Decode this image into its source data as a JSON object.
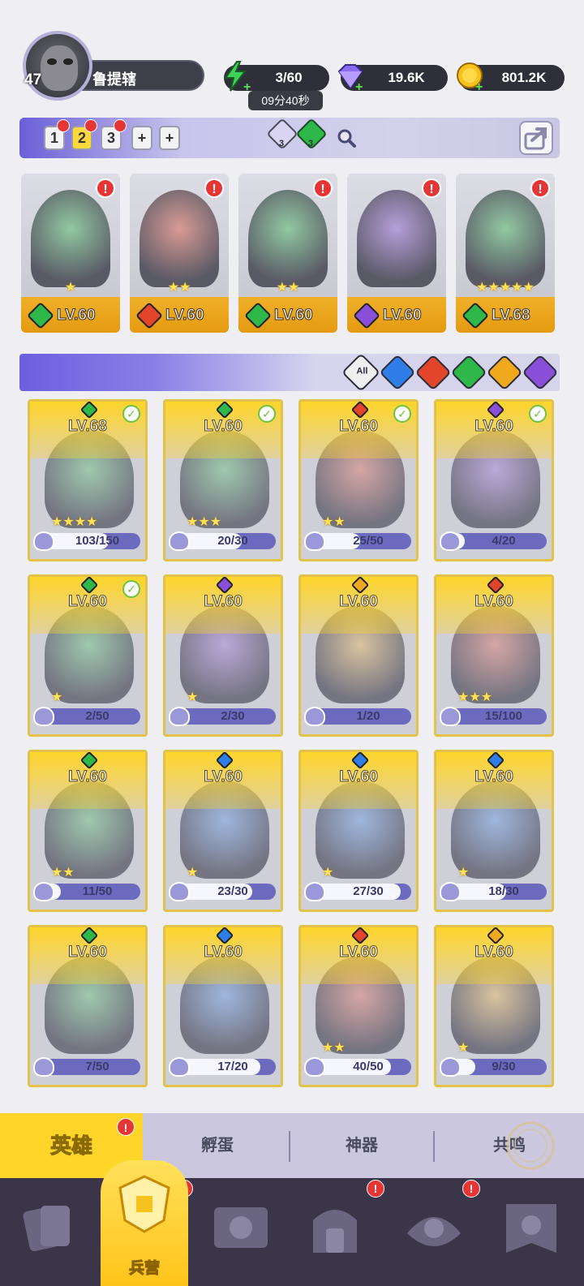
{
  "player": {
    "level": "47",
    "name": "鲁提辖"
  },
  "resources": {
    "energy": "3/60",
    "energy_timer": "09分40秒",
    "gems": "19.6K",
    "gold": "801.2K"
  },
  "team_bar": {
    "slots": [
      "1",
      "2",
      "3",
      "+",
      "+"
    ],
    "active_slot": 1,
    "gem_counts": [
      "3",
      "3"
    ]
  },
  "team": [
    {
      "element": "green",
      "level": "LV.60",
      "stars": "★",
      "alert": "!"
    },
    {
      "element": "red",
      "level": "LV.60",
      "stars": "★★",
      "alert": "!"
    },
    {
      "element": "green",
      "level": "LV.60",
      "stars": "★★",
      "alert": "!"
    },
    {
      "element": "purple",
      "level": "LV.60",
      "stars": "",
      "alert": "!"
    },
    {
      "element": "green",
      "level": "LV.68",
      "stars": "★★★★★",
      "alert": "!"
    }
  ],
  "filters": {
    "all_label": "All",
    "elements": [
      "blue",
      "red",
      "green",
      "yellow",
      "purple"
    ]
  },
  "heroes": [
    {
      "element": "green",
      "level": "LV.68",
      "shards": "103/150",
      "progress": 0.69,
      "check": true,
      "stars": "★★★★"
    },
    {
      "element": "green",
      "level": "LV.60",
      "shards": "20/30",
      "progress": 0.67,
      "check": true,
      "stars": "★★★"
    },
    {
      "element": "red",
      "level": "LV.60",
      "shards": "25/50",
      "progress": 0.5,
      "check": true,
      "stars": "★★"
    },
    {
      "element": "purple",
      "level": "LV.60",
      "shards": "4/20",
      "progress": 0.2,
      "check": true,
      "stars": ""
    },
    {
      "element": "green",
      "level": "LV.60",
      "shards": "2/50",
      "progress": 0.04,
      "check": true,
      "stars": "★"
    },
    {
      "element": "purple",
      "level": "LV.60",
      "shards": "2/30",
      "progress": 0.07,
      "check": false,
      "stars": "★"
    },
    {
      "element": "yellow",
      "level": "LV.60",
      "shards": "1/20",
      "progress": 0.05,
      "check": false,
      "stars": ""
    },
    {
      "element": "red",
      "level": "LV.60",
      "shards": "15/100",
      "progress": 0.15,
      "check": false,
      "stars": "★★★"
    },
    {
      "element": "green",
      "level": "LV.60",
      "shards": "11/50",
      "progress": 0.22,
      "check": false,
      "stars": "★★"
    },
    {
      "element": "blue",
      "level": "LV.60",
      "shards": "23/30",
      "progress": 0.77,
      "check": false,
      "stars": "★"
    },
    {
      "element": "blue",
      "level": "LV.60",
      "shards": "27/30",
      "progress": 0.9,
      "check": false,
      "stars": "★"
    },
    {
      "element": "blue",
      "level": "LV.60",
      "shards": "18/30",
      "progress": 0.6,
      "check": false,
      "stars": "★"
    },
    {
      "element": "green",
      "level": "LV.60",
      "shards": "7/50",
      "progress": 0.14,
      "check": false,
      "stars": ""
    },
    {
      "element": "blue",
      "level": "LV.60",
      "shards": "17/20",
      "progress": 0.85,
      "check": false,
      "stars": ""
    },
    {
      "element": "red",
      "level": "LV.60",
      "shards": "40/50",
      "progress": 0.8,
      "check": false,
      "stars": "★★"
    },
    {
      "element": "yellow",
      "level": "LV.60",
      "shards": "9/30",
      "progress": 0.3,
      "check": false,
      "stars": "★"
    }
  ],
  "sub_tabs": [
    "英雄",
    "孵蛋",
    "神器",
    "共鸣"
  ],
  "sub_tab_alert": "!",
  "bottom_nav": {
    "active_label": "兵营",
    "alerts": [
      "!",
      "!",
      "!"
    ]
  },
  "colors": {
    "green": "#2fb84a",
    "red": "#e2452a",
    "blue": "#2f7ee8",
    "yellow": "#f0a81c",
    "purple": "#8a4fd8",
    "accent": "#ffd52a",
    "panel": "#6b5fd8"
  }
}
